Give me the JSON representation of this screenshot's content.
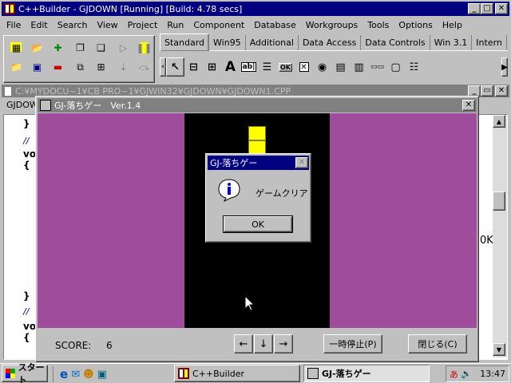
{
  "ide": {
    "title": "C++Builder - GJDOWN [Running] [Build: 4.78 secs]",
    "menu": [
      "File",
      "Edit",
      "Search",
      "View",
      "Project",
      "Run",
      "Component",
      "Database",
      "Workgroups",
      "Tools",
      "Options",
      "Help"
    ],
    "tabs": [
      "Standard",
      "Win95",
      "Additional",
      "Data Access",
      "Data Controls",
      "Win 3.1",
      "Intern"
    ]
  },
  "editor": {
    "title": "C:¥MYDOCU~1¥CB PRO~1¥GJWIN32¥GJDOWN¥GJDOWN1.CPP",
    "tab_label": "GJDOW",
    "code_lines": [
      "}",
      "//",
      "vo",
      "{",
      "}",
      "//",
      "vo",
      "{"
    ],
    "right_text": "0K"
  },
  "game": {
    "title": "GJ-落ちゲー　Ver.1.4",
    "score_label": "SCORE:",
    "score_value": "6",
    "left_btn": "←",
    "down_btn": "↓",
    "right_btn": "→",
    "pause_btn": "一時停止(P)",
    "close_btn": "閉じる(C)",
    "colors": {
      "field": "#a04c9c",
      "board": "#000000",
      "block": "#ffff00"
    }
  },
  "dialog": {
    "title": "GJ-落ちゲー",
    "message": "ゲームクリア",
    "ok": "OK"
  },
  "taskbar": {
    "start": "スタート",
    "tasks": [
      "C++Builder",
      "GJ-落ちゲー"
    ],
    "time": "13:47"
  }
}
